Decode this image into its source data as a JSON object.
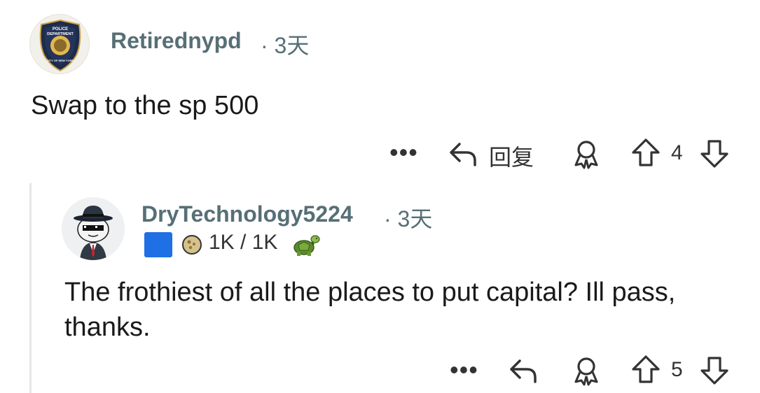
{
  "comment1": {
    "username": "Retirednypd",
    "separator": "·",
    "time": "3天",
    "badge_text": [
      "POLICE",
      "DEPARTMENT",
      "CITY OF NEW YORK"
    ],
    "body": "Swap to the sp 500",
    "actions": {
      "more_label": "•••",
      "reply_label": "回复",
      "score": "4"
    }
  },
  "comment2": {
    "username": "DryTechnology5224",
    "separator": "·",
    "time": "3天",
    "flair_color": "#1f6fe5",
    "karma": "1K / 1K",
    "body": "The frothiest of all the places to put capital? Ill pass, thanks.",
    "actions": {
      "more_label": "•••",
      "score": "5"
    }
  },
  "icons": [
    "reply-arrow-icon",
    "award-icon",
    "upvote-icon",
    "downvote-icon",
    "coin-icon",
    "turtle-icon"
  ]
}
